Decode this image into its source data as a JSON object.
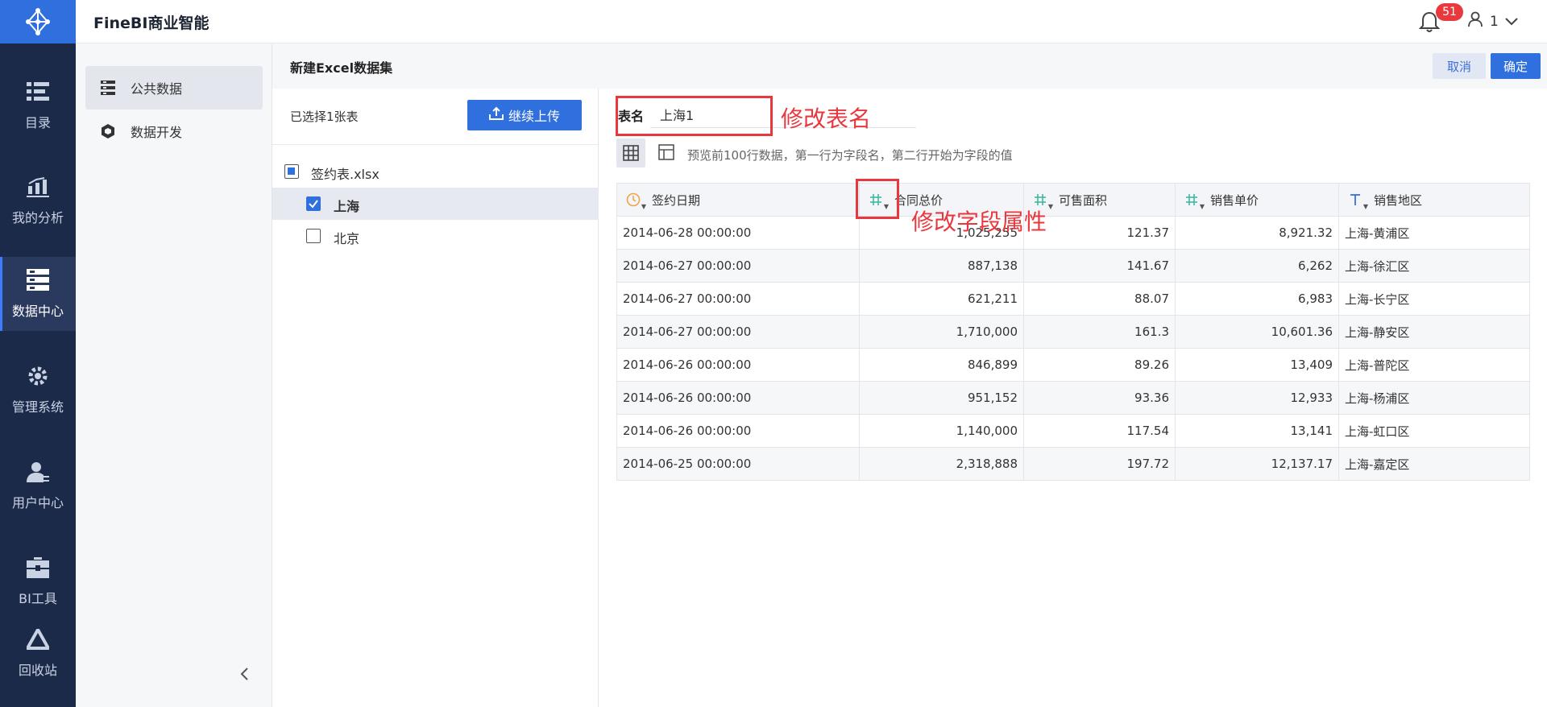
{
  "app": {
    "brand": "FineBI商业智能"
  },
  "header": {
    "notification_count": "51",
    "user_name": "1"
  },
  "nav": {
    "items": [
      {
        "label": "目录",
        "icon": "catalog-icon"
      },
      {
        "label": "我的分析",
        "icon": "analysis-chart-icon"
      },
      {
        "label": "数据中心",
        "icon": "data-center-icon",
        "active": true
      },
      {
        "label": "管理系统",
        "icon": "gear-icon"
      },
      {
        "label": "用户中心",
        "icon": "user-icon"
      },
      {
        "label": "BI工具",
        "icon": "toolbox-icon"
      },
      {
        "label": "回收站",
        "icon": "recycle-icon"
      }
    ]
  },
  "sidebar": {
    "items": [
      {
        "label": "公共数据",
        "icon": "server-icon",
        "active": true
      },
      {
        "label": "数据开发",
        "icon": "cube-icon"
      }
    ]
  },
  "page": {
    "title": "新建Excel数据集",
    "cancel_label": "取消",
    "confirm_label": "确定"
  },
  "files": {
    "selected_count": "已选择1张表",
    "upload_label": "继续上传",
    "workbook": {
      "name": "签约表.xlsx",
      "state": "partial"
    },
    "sheets": [
      {
        "name": "上海",
        "checked": true
      },
      {
        "name": "北京",
        "checked": false
      }
    ]
  },
  "detail": {
    "table_name_label": "表名",
    "table_name_value": "上海1",
    "preview_note": "预览前100行数据，第一行为字段名，第二行开始为字段的值"
  },
  "table": {
    "columns": [
      {
        "name": "签约日期",
        "type": "date",
        "type_icon": "clock-icon"
      },
      {
        "name": "合同总价",
        "type": "number",
        "type_icon": "hash-icon"
      },
      {
        "name": "可售面积",
        "type": "number",
        "type_icon": "hash-icon"
      },
      {
        "name": "销售单价",
        "type": "number",
        "type_icon": "hash-icon"
      },
      {
        "name": "销售地区",
        "type": "text",
        "type_icon": "text-t-icon"
      }
    ],
    "rows": [
      [
        "2014-06-28 00:00:00",
        "1,025,255",
        "121.37",
        "8,921.32",
        "上海-黄浦区"
      ],
      [
        "2014-06-27 00:00:00",
        "887,138",
        "141.67",
        "6,262",
        "上海-徐汇区"
      ],
      [
        "2014-06-27 00:00:00",
        "621,211",
        "88.07",
        "6,983",
        "上海-长宁区"
      ],
      [
        "2014-06-27 00:00:00",
        "1,710,000",
        "161.3",
        "10,601.36",
        "上海-静安区"
      ],
      [
        "2014-06-26 00:00:00",
        "846,899",
        "89.26",
        "13,409",
        "上海-普陀区"
      ],
      [
        "2014-06-26 00:00:00",
        "951,152",
        "93.36",
        "12,933",
        "上海-杨浦区"
      ],
      [
        "2014-06-26 00:00:00",
        "1,140,000",
        "117.54",
        "13,141",
        "上海-虹口区"
      ],
      [
        "2014-06-25 00:00:00",
        "2,318,888",
        "197.72",
        "12,137.17",
        "上海-嘉定区"
      ]
    ]
  },
  "annotations": {
    "rename_table": "修改表名",
    "change_field_type": "修改字段属性"
  },
  "colors": {
    "primary": "#2f6fde",
    "nav_bg": "#1c2a4a",
    "annotation_red": "#e8383d",
    "date_icon": "#f0a44a",
    "number_icon": "#3fb8a0",
    "text_icon": "#3d6fd8"
  }
}
